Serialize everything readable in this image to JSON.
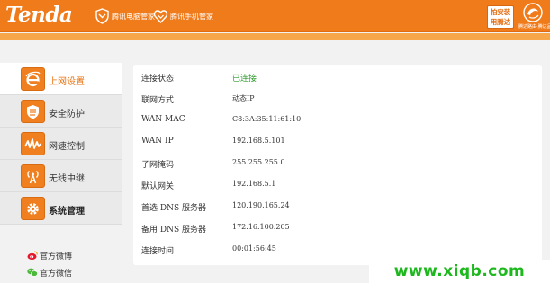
{
  "header": {
    "logo": "Tenda",
    "partners": [
      {
        "label": "腾讯电脑管家",
        "icon": "shield-icon"
      },
      {
        "label": "腾讯手机管家",
        "icon": "heart-shield-icon"
      }
    ],
    "badge_line1": "怕安装",
    "badge_line2": "用腾达",
    "brand_caption": "腾达路由·腾达品质",
    "colors": {
      "header": "#f07b1b",
      "strip": "#f7a64a",
      "accent": "#e8720f",
      "status_ok": "#2e9b2e"
    }
  },
  "sidebar": {
    "items": [
      {
        "label": "上网设置",
        "icon": "internet-explorer-icon",
        "active": true
      },
      {
        "label": "安全防护",
        "icon": "shield-icon",
        "active": false
      },
      {
        "label": "网速控制",
        "icon": "speed-wave-icon",
        "active": false
      },
      {
        "label": "无线中继",
        "icon": "wireless-tower-icon",
        "active": false
      },
      {
        "label": "系统管理",
        "icon": "gear-icon",
        "active": false
      }
    ],
    "social": [
      {
        "label": "官方微博",
        "icon": "weibo-icon"
      },
      {
        "label": "官方微信",
        "icon": "wechat-icon"
      }
    ]
  },
  "status": {
    "rows": [
      {
        "key": "连接状态",
        "value": "已连接"
      },
      {
        "key": "联网方式",
        "value": "动态IP"
      },
      {
        "key": "WAN MAC",
        "value": "C8:3A:35:11:61:10"
      },
      {
        "key": "WAN IP",
        "value": "192.168.5.101"
      },
      {
        "key": "子网掩码",
        "value": "255.255.255.0"
      },
      {
        "key": "默认网关",
        "value": "192.168.5.1"
      },
      {
        "key": "首选 DNS 服务器",
        "value": "120.190.165.24"
      },
      {
        "key": "备用 DNS 服务器",
        "value": "172.16.100.205"
      },
      {
        "key": "连接时间",
        "value": "00:01:56:45"
      }
    ]
  },
  "watermark": "www.xiqb.com"
}
